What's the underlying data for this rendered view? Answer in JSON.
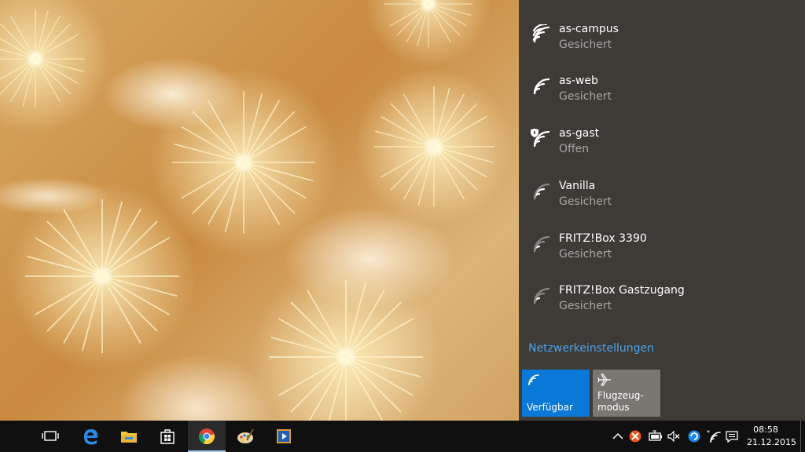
{
  "networks": [
    {
      "name": "as-campus",
      "status": "Gesichert",
      "icon": "wifi-icon"
    },
    {
      "name": "as-web",
      "status": "Gesichert",
      "icon": "wifi-icon"
    },
    {
      "name": "as-gast",
      "status": "Offen",
      "icon": "wifi-shield-icon"
    },
    {
      "name": "Vanilla",
      "status": "Gesichert",
      "icon": "wifi-weak-icon"
    },
    {
      "name": "FRITZ!Box 3390",
      "status": "Gesichert",
      "icon": "wifi-weak-icon"
    },
    {
      "name": "FRITZ!Box Gastzugang",
      "status": "Gesichert",
      "icon": "wifi-weak-icon"
    }
  ],
  "settings_link": "Netzwerkeinstellungen",
  "quick_actions": {
    "wifi": {
      "label": "Verfügbar",
      "icon": "wifi-icon",
      "color": "#0a78d6"
    },
    "airplane": {
      "label_line1": "Flugzeug-",
      "label_line2": "modus",
      "icon": "airplane-icon",
      "color": "#7a7672"
    }
  },
  "taskbar": {
    "apps": [
      "task-view-icon",
      "edge-icon",
      "file-explorer-icon",
      "store-icon",
      "chrome-icon",
      "paint-icon",
      "media-player-icon"
    ],
    "active_app": "chrome-icon"
  },
  "tray": {
    "icons": [
      "chevron-up-icon",
      "antivirus-icon",
      "battery-icon",
      "volume-muted-icon",
      "sync-icon",
      "network-icon",
      "notification-icon"
    ],
    "time": "08:58",
    "date": "21.12.2015"
  },
  "colors": {
    "accent": "#0a78d6",
    "link": "#4aa3ec",
    "flyout_bg": "#3e3b37",
    "taskbar_bg": "#101010"
  }
}
